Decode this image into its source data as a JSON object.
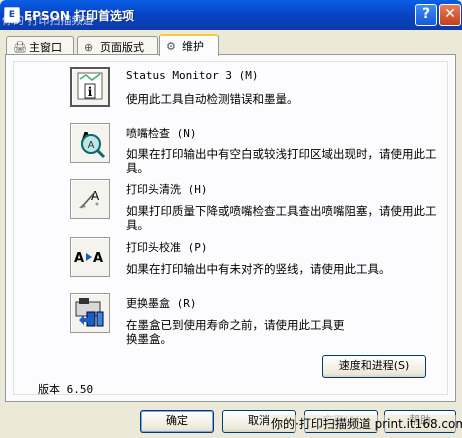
{
  "window": {
    "title": "EPSON 打印首选项",
    "title_overlay": "你的·打印扫描频道",
    "help_glyph": "?",
    "close_glyph": "✕"
  },
  "tabs": [
    {
      "label": "主窗口",
      "icon": "printer-icon"
    },
    {
      "label": "页面版式",
      "icon": "layout-icon"
    },
    {
      "label": "维护",
      "icon": "maintenance-icon"
    }
  ],
  "tools": [
    {
      "title": "Status Monitor 3 (M)",
      "desc": "使用此工具自动检测错误和墨量。",
      "icon": "status-monitor-icon"
    },
    {
      "title": "喷嘴检查 (N)",
      "desc": "如果在打印输出中有空白或较浅打印区域出现时，请使用此工具。",
      "icon": "nozzle-check-icon"
    },
    {
      "title": "打印头清洗 (H)",
      "desc": "如果打印质量下降或喷嘴检查工具查出喷嘴阻塞，请使用此工具。",
      "icon": "head-cleaning-icon"
    },
    {
      "title": "打印头校准 (P)",
      "desc": "如果在打印输出中有未对齐的竖线，请使用此工具。",
      "icon": "head-alignment-icon"
    },
    {
      "title": "更换墨盒 (R)",
      "desc": "在墨盒已到使用寿命之前，请使用此工具更换墨盒。",
      "icon": "ink-cartridge-icon"
    }
  ],
  "speed_button": "速度和进程(S)",
  "version": "版本 6.50",
  "footer": {
    "ok": "确定",
    "cancel": "取消",
    "apply": "应用(A)",
    "help": "帮助"
  },
  "watermark": "你的·打印扫描频道 print.it168.com"
}
